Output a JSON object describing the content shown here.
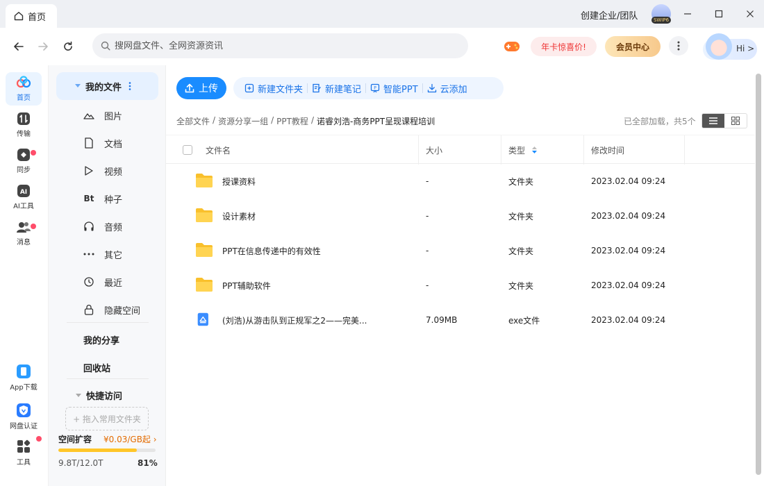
{
  "titlebar": {
    "tab_label": "首页",
    "enterprise": "创建企业/团队",
    "svip_badge": "SWIP6"
  },
  "navbar": {
    "search_placeholder": "搜网盘文件、全网资源资讯",
    "promo_label": "年卡惊喜价!",
    "vip_center_label": "会员中心",
    "hi_label": "Hi >"
  },
  "rail": {
    "items": [
      {
        "label": "首页",
        "icon": "cloud-logo-icon",
        "active": true
      },
      {
        "label": "传输",
        "icon": "transfer-icon"
      },
      {
        "label": "同步",
        "icon": "sync-icon"
      },
      {
        "label": "AI工具",
        "icon": "ai-icon"
      },
      {
        "label": "消息",
        "icon": "message-icon"
      }
    ],
    "bottom": [
      {
        "label": "App下载",
        "icon": "phone-icon"
      },
      {
        "label": "网盘认证",
        "icon": "verify-icon"
      },
      {
        "label": "工具",
        "icon": "tools-icon"
      }
    ]
  },
  "sidebar": {
    "my_files": "我的文件",
    "categories": [
      {
        "label": "图片",
        "icon": "image-icon"
      },
      {
        "label": "文档",
        "icon": "document-icon"
      },
      {
        "label": "视频",
        "icon": "video-icon"
      },
      {
        "label": "种子",
        "icon": "bt-icon",
        "glyph": "Bt"
      },
      {
        "label": "音频",
        "icon": "headphones-icon"
      },
      {
        "label": "其它",
        "icon": "more-icon"
      },
      {
        "label": "最近",
        "icon": "clock-icon"
      },
      {
        "label": "隐藏空间",
        "icon": "lock-icon"
      }
    ],
    "my_share": "我的分享",
    "recycle": "回收站",
    "quick_access": "快捷访问",
    "drop_zone": "+ 拖入常用文件夹",
    "storage": {
      "label": "空间扩容",
      "price": "¥0.03/GB起",
      "used_text": "9.8T/12.0T",
      "percent_text": "81%",
      "percent": 81
    }
  },
  "main": {
    "upload_label": "上传",
    "toolbar": [
      "新建文件夹",
      "新建笔记",
      "智能PPT",
      "云添加"
    ],
    "breadcrumb": [
      "全部文件",
      "资源分享一组",
      "PPT教程"
    ],
    "breadcrumb_current": "诺睿刘浩-商务PPT呈现课程培训",
    "loaded_text": "已全部加载，共5个",
    "columns": {
      "name": "文件名",
      "size": "大小",
      "type": "类型",
      "modified": "修改时间"
    },
    "files": [
      {
        "name": "授课资料",
        "size": "-",
        "type": "文件夹",
        "modified": "2023.02.04 09:24",
        "kind": "folder"
      },
      {
        "name": "设计素材",
        "size": "-",
        "type": "文件夹",
        "modified": "2023.02.04 09:24",
        "kind": "folder"
      },
      {
        "name": "PPT在信息传递中的有效性",
        "size": "-",
        "type": "文件夹",
        "modified": "2023.02.04 09:24",
        "kind": "folder"
      },
      {
        "name": "PPT辅助软件",
        "size": "-",
        "type": "文件夹",
        "modified": "2023.02.04 09:24",
        "kind": "folder"
      },
      {
        "name": "(刘浩)从游击队到正规军之2——完美...",
        "size": "7.09MB",
        "type": "exe文件",
        "modified": "2023.02.04 09:24",
        "kind": "exe"
      }
    ]
  },
  "colors": {
    "accent": "#1a8cff",
    "promo": "#e33333",
    "storage_fill": "#ffc629",
    "folder": "#ffc629"
  }
}
